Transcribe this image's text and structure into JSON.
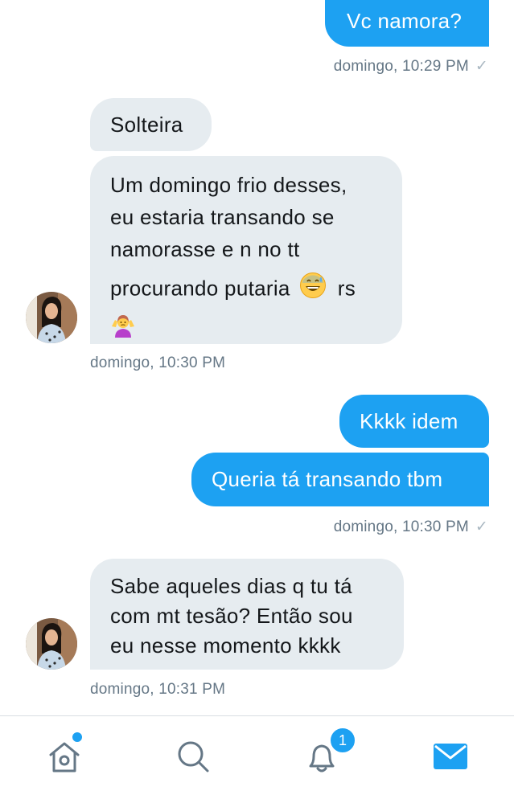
{
  "conversation": {
    "messages": [
      {
        "direction": "outgoing",
        "text": "Vc namora?"
      },
      {
        "direction": "outgoing",
        "timestamp": "domingo, 10:29 PM",
        "status": "sent-check-icon"
      },
      {
        "direction": "incoming",
        "text": "Solteira"
      },
      {
        "direction": "incoming",
        "lines": [
          "Um domingo frio desses,",
          "eu estaria transando se",
          "namorasse e n no tt",
          "procurando putaria",
          "rs"
        ],
        "emojis": [
          "grinning-sweat-emoji",
          "person-shrugging-emoji"
        ]
      },
      {
        "direction": "incoming",
        "timestamp": "domingo, 10:30 PM"
      },
      {
        "direction": "outgoing",
        "text": "Kkkk idem"
      },
      {
        "direction": "outgoing",
        "text": "Queria tá transando tbm"
      },
      {
        "direction": "outgoing",
        "timestamp": "domingo, 10:30 PM",
        "status": "sent-check-icon"
      },
      {
        "direction": "incoming",
        "lines": [
          "Sabe aqueles dias q tu tá",
          "com mt tesão? Então sou",
          "eu nesse momento kkkk"
        ]
      },
      {
        "direction": "incoming",
        "timestamp": "domingo, 10:31 PM"
      }
    ],
    "check_glyph": "✓"
  },
  "tabbar": {
    "items": [
      {
        "name": "home",
        "icon": "home-icon",
        "indicator": "dot"
      },
      {
        "name": "search",
        "icon": "search-icon"
      },
      {
        "name": "notifications",
        "icon": "bell-icon",
        "badge": "1"
      },
      {
        "name": "messages",
        "icon": "envelope-icon",
        "active": true
      }
    ],
    "accent_color": "#1DA1F2",
    "inactive_color": "#657786"
  },
  "colors": {
    "outgoing_bubble": "#1DA1F2",
    "incoming_bubble": "#E6ECF0",
    "incoming_text": "#14171A",
    "meta_text": "#657786"
  }
}
